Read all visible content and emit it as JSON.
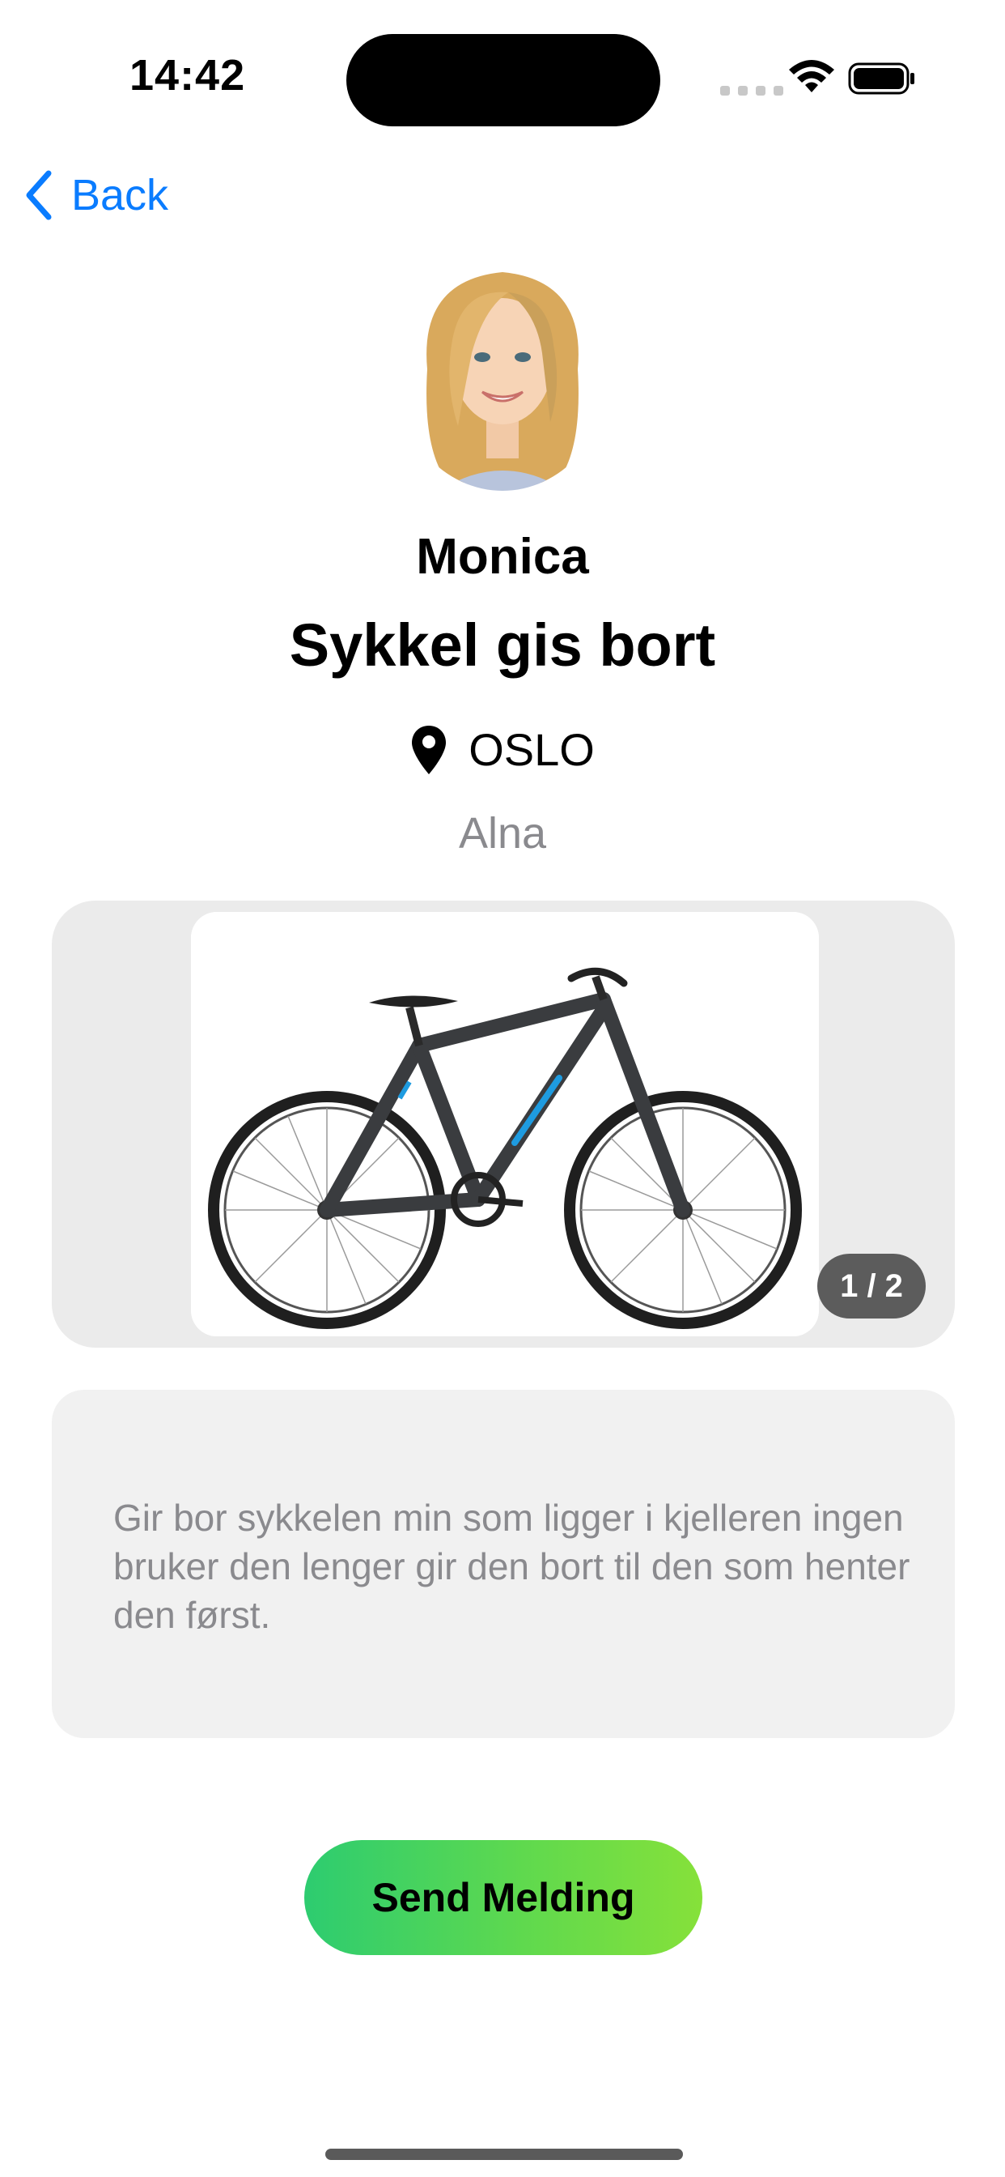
{
  "status_bar": {
    "time": "14:42",
    "icons": [
      "cellular-signal-icon",
      "wifi-icon",
      "battery-icon"
    ]
  },
  "nav": {
    "back_label": "Back",
    "back_icon": "chevron-left-icon",
    "accent_color": "#0a7cff"
  },
  "seller": {
    "name": "Monica",
    "avatar": "avatar-photo"
  },
  "listing": {
    "title": "Sykkel gis bort",
    "location_icon": "location-pin-icon",
    "city": "OSLO",
    "district": "Alna",
    "image_counter": "1 / 2",
    "image_current": 1,
    "image_total": 2,
    "description": "Gir bor sykkelen min som ligger i kjelleren ingen bruker den lenger gir den bort til den som henter den først."
  },
  "actions": {
    "send_label": "Send Melding",
    "gradient_colors": [
      "#2dcc70",
      "#86e13a"
    ]
  }
}
